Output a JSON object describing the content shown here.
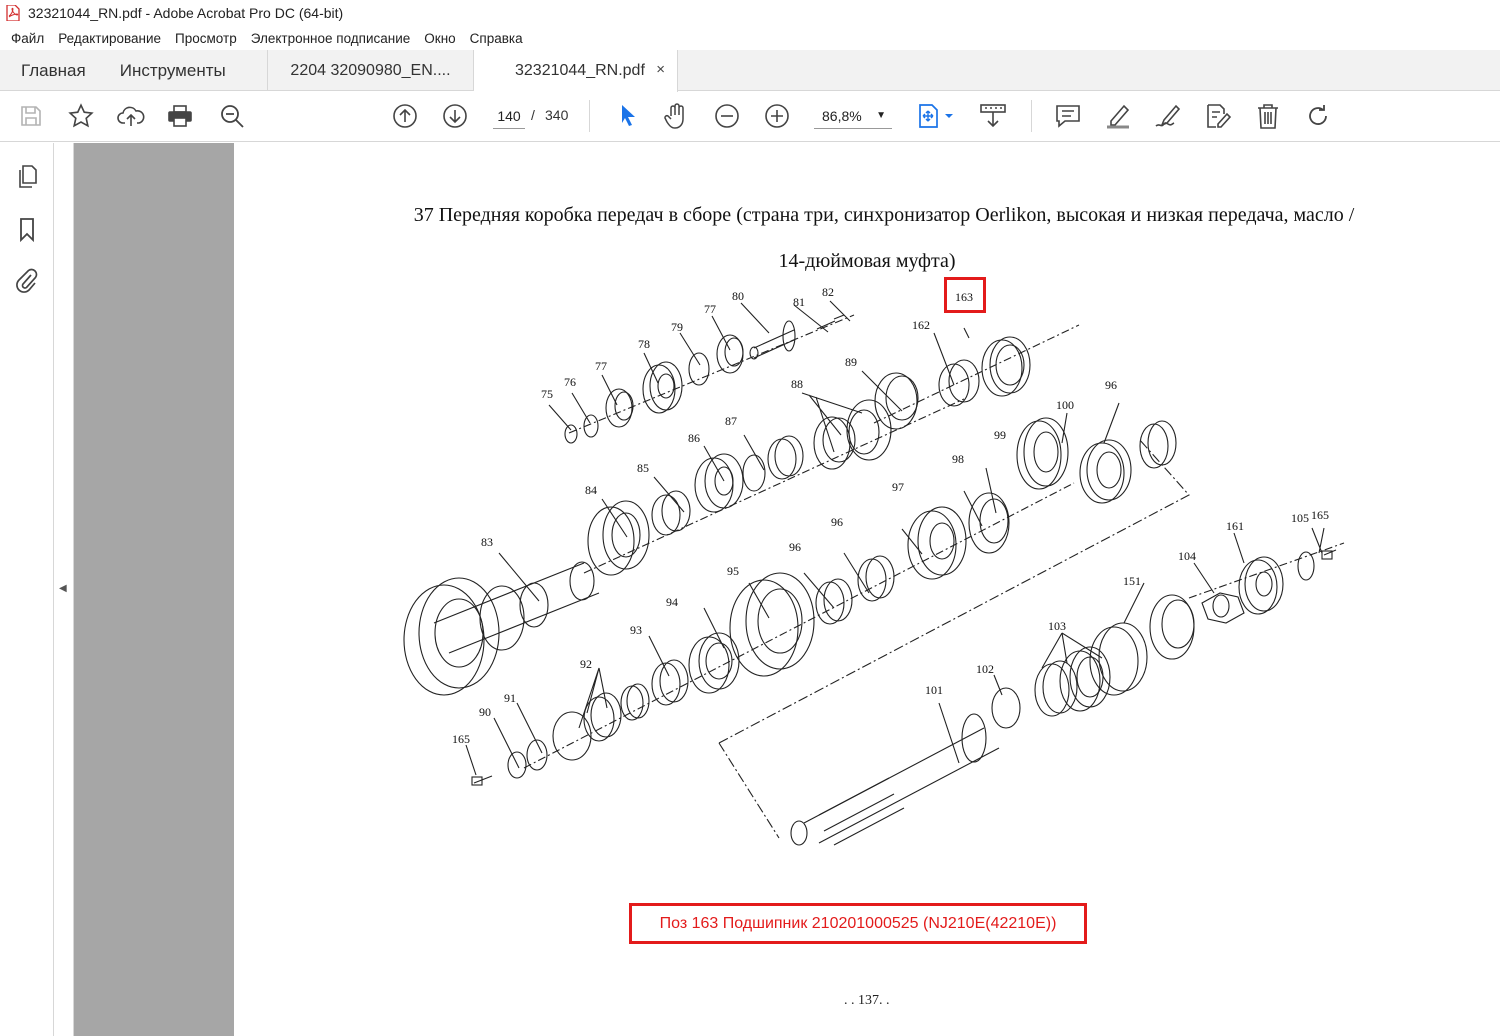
{
  "window": {
    "title": "32321044_RN.pdf - Adobe Acrobat Pro DC (64-bit)"
  },
  "menu": [
    "Файл",
    "Редактирование",
    "Просмотр",
    "Электронное подписание",
    "Окно",
    "Справка"
  ],
  "tabs": {
    "home": "Главная",
    "tools": "Инструменты",
    "doc1": "2204 32090980_EN....",
    "doc2": "32321044_RN.pdf",
    "close": "×"
  },
  "toolbar": {
    "page_current": "140",
    "page_sep": "/",
    "page_total": "340",
    "zoom": "86,8%"
  },
  "document": {
    "title_line1": "37 Передняя коробка передач в сборе (страна три, синхронизатор Oerlikon, высокая и низкая передача, масло /",
    "title_line2": "14-дюймовая муфта)",
    "highlight_note": "Поз 163 Подшипник 210201000525 (NJ210E(42210E))",
    "page_number": ". . 137. .",
    "part_labels": [
      "75",
      "76",
      "77",
      "78",
      "79",
      "77",
      "80",
      "81",
      "82",
      "163",
      "162",
      "89",
      "88",
      "87",
      "86",
      "85",
      "84",
      "83",
      "96",
      "100",
      "99",
      "98",
      "97",
      "96",
      "96",
      "95",
      "94",
      "93",
      "92",
      "91",
      "90",
      "165",
      "161",
      "105",
      "165",
      "104",
      "151",
      "103",
      "102",
      "101"
    ]
  },
  "colors": {
    "accent_red": "#e31b1b",
    "viewer_gray": "#a6a6a6",
    "acrobat_blue": "#1a73e8"
  }
}
